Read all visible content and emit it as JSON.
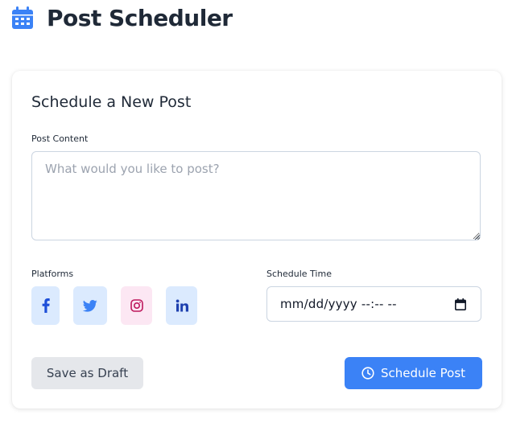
{
  "header": {
    "title": "Post Scheduler",
    "icon": "calendar-icon",
    "icon_color": "#3b82f6"
  },
  "form": {
    "title": "Schedule a New Post",
    "content_label": "Post Content",
    "content_value": "",
    "content_placeholder": "What would you like to post?",
    "platforms_label": "Platforms",
    "platforms": [
      {
        "name": "facebook",
        "icon": "facebook-icon",
        "color": "#1d4ed8",
        "bg": "#dbeafe"
      },
      {
        "name": "twitter",
        "icon": "twitter-icon",
        "color": "#3b82f6",
        "bg": "#dbeafe"
      },
      {
        "name": "instagram",
        "icon": "instagram-icon",
        "color": "#be185d",
        "bg": "#fce7f3"
      },
      {
        "name": "linkedin",
        "icon": "linkedin-icon",
        "color": "#1e40af",
        "bg": "#dbeafe"
      }
    ],
    "schedule_label": "Schedule Time",
    "schedule_value": "mm/dd/yyyy --:-- --",
    "draft_label": "Save as Draft",
    "schedule_button_label": "Schedule Post"
  },
  "colors": {
    "accent": "#3b82f6",
    "secondary_button": "#e5e7eb",
    "text": "#1f2937",
    "border": "#cbd5e1"
  }
}
